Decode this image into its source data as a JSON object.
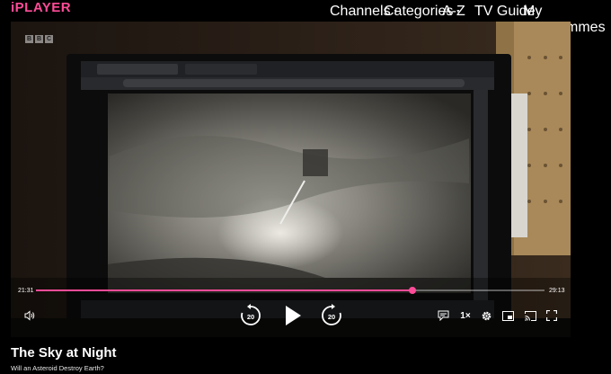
{
  "brand": {
    "logo": "iPLAYER",
    "accent_color": "#ff4c98"
  },
  "nav": {
    "channels": "Channels",
    "categories": "Categories",
    "az": "A-Z",
    "tv_guide": "TV Guide",
    "my_programmes": "My Programmes",
    "dropdown_icon": "caret-down-icon"
  },
  "player": {
    "channel_badge": [
      "B",
      "B",
      "C"
    ],
    "elapsed_time": "21:31",
    "remaining_time": "29:13",
    "progress_fraction": 0.74,
    "rewind_seconds": "20",
    "forward_seconds": "20",
    "speed_label": "1×",
    "icons": {
      "volume": "speaker-icon",
      "rewind": "rewind-20-icon",
      "play": "play-icon",
      "forward": "forward-20-icon",
      "subtitles": "subtitles-icon",
      "settings": "gear-icon",
      "pip": "picture-in-picture-icon",
      "cast": "cast-icon",
      "fullscreen": "fullscreen-icon"
    }
  },
  "programme": {
    "title": "The Sky at Night",
    "episode": "Will an Asteroid Destroy Earth?"
  }
}
